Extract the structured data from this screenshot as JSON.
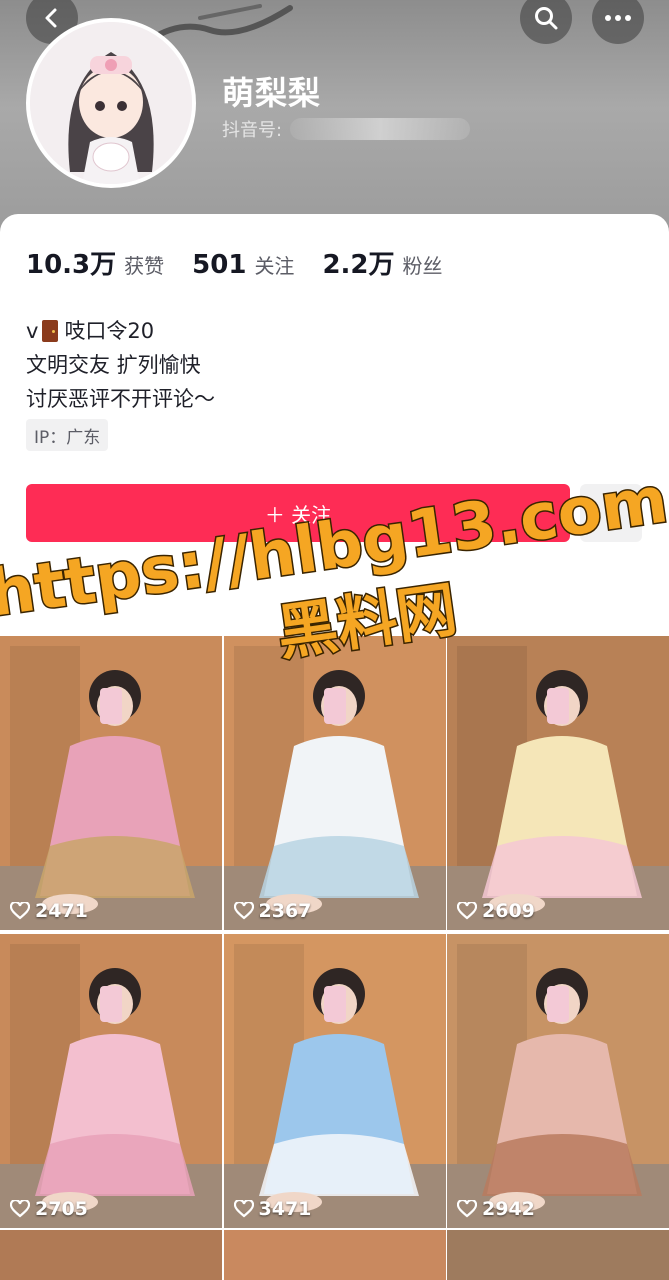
{
  "profile": {
    "nickname": "萌梨梨",
    "account_label": "抖音号:",
    "stats": [
      {
        "value": "10.3万",
        "label": "获赞"
      },
      {
        "value": "501",
        "label": "关注"
      },
      {
        "value": "2.2万",
        "label": "粉丝"
      }
    ],
    "bio": {
      "line1_prefix": "v",
      "line1_suffix": "吱口令20",
      "line2": "文明交友 扩列愉快",
      "line3": "讨厌恶评不开评论～"
    },
    "ip": "IP：广东",
    "follow_label": "＋ 关注"
  },
  "watermark": {
    "line1": "https://hlbg13.com",
    "line2": "黑料网"
  },
  "posts": [
    {
      "likes": "2471",
      "outfit": "#e8a2b8",
      "accent": "#c9a46a",
      "wall": "#c98b5b"
    },
    {
      "likes": "2367",
      "outfit": "#f1f4f7",
      "accent": "#b9d3e3",
      "wall": "#d0915f"
    },
    {
      "likes": "2609",
      "outfit": "#f5e6b8",
      "accent": "#f4c7d3",
      "wall": "#b88156"
    },
    {
      "likes": "2705",
      "outfit": "#f3bfcf",
      "accent": "#e7a1b8",
      "wall": "#c88a5b"
    },
    {
      "likes": "3471",
      "outfit": "#9cc7ec",
      "accent": "#f4f7fb",
      "wall": "#d49661"
    },
    {
      "likes": "2942",
      "outfit": "#e6b8ac",
      "accent": "#b97a5e",
      "wall": "#c79365"
    }
  ],
  "colors": {
    "follow": "#fe2c55",
    "text": "#161823",
    "secondary": "#5c5d66"
  }
}
